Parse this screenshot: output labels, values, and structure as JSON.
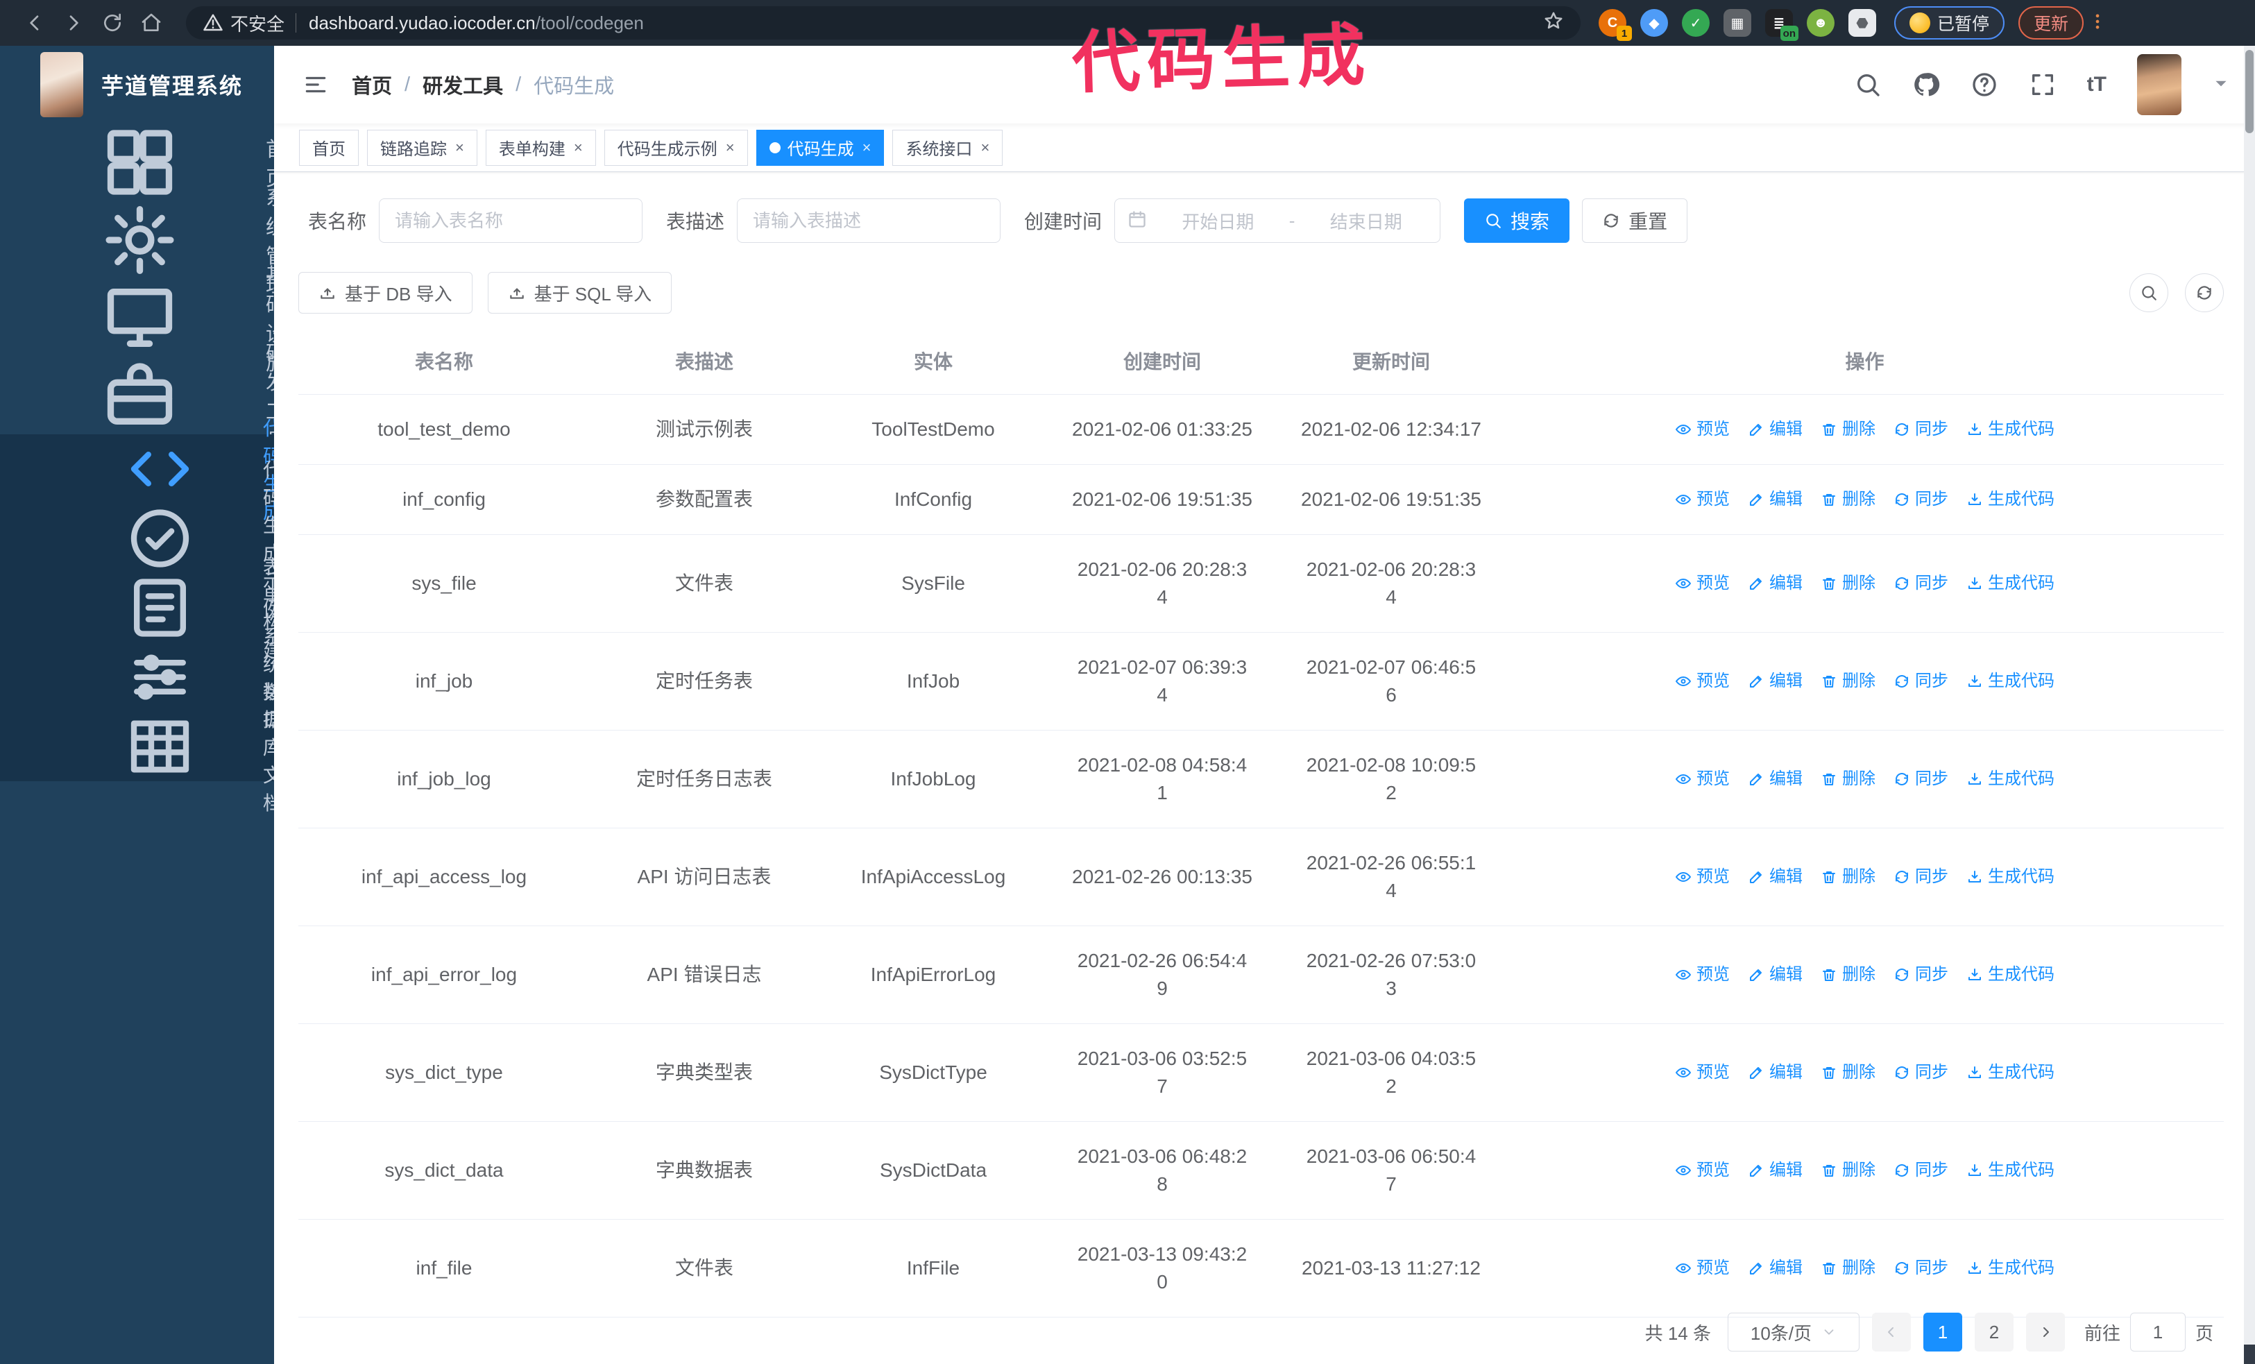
{
  "colors": {
    "primary": "#1890ff",
    "sidebar_bg": "#20415c",
    "submenu_bg": "#17334b",
    "annotation": "#f1315f",
    "active_menu": "#409eff"
  },
  "annotation": {
    "text": "代码生成"
  },
  "browser": {
    "security_label": "不安全",
    "url_host": "dashboard.yudao.iocoder.cn",
    "url_path": "/tool/codegen",
    "paused_badge": "已暂停",
    "update_button": "更新",
    "extensions": [
      {
        "name": "extension-refresh-icon",
        "shape": "round",
        "color": "#e8710a",
        "glyph": "C",
        "badge": "1",
        "badge_color": "#f9ab00"
      },
      {
        "name": "extension-gem-icon",
        "shape": "round",
        "color": "#4f9cf7",
        "glyph": "◆",
        "badge": "",
        "badge_color": ""
      },
      {
        "name": "extension-check-icon",
        "shape": "round",
        "color": "#34a853",
        "glyph": "✓",
        "badge": "",
        "badge_color": ""
      },
      {
        "name": "extension-grid-icon",
        "shape": "",
        "color": "#5f6368",
        "glyph": "▦",
        "badge": "",
        "badge_color": ""
      },
      {
        "name": "extension-clip-icon",
        "shape": "",
        "color": "#202124",
        "glyph": "≣",
        "badge": "on",
        "badge_color": "#34a853"
      },
      {
        "name": "extension-bot-icon",
        "shape": "round",
        "color": "#7cb342",
        "glyph": "☻",
        "badge": "",
        "badge_color": ""
      },
      {
        "name": "extension-puzzle-icon",
        "shape": "",
        "color": "#e8eaed",
        "glyph": "⬣",
        "badge": "",
        "badge_color": ""
      }
    ]
  },
  "app": {
    "title": "芋道管理系统"
  },
  "breadcrumb": {
    "items": [
      "首页",
      "研发工具",
      "代码生成"
    ],
    "separator": "/"
  },
  "sidebar": {
    "items": [
      {
        "label": "首页",
        "icon": "dashboard",
        "chevron": ""
      },
      {
        "label": "系统管理",
        "icon": "gear",
        "chevron": "down"
      },
      {
        "label": "基础设施",
        "icon": "monitor",
        "chevron": "down"
      },
      {
        "label": "研发工具",
        "icon": "toolbox",
        "chevron": "up"
      }
    ],
    "submenu": [
      {
        "label": "代码生成",
        "icon": "code",
        "active": true
      },
      {
        "label": "代码生成示例",
        "icon": "check-circle",
        "active": false
      },
      {
        "label": "表单构建",
        "icon": "form",
        "active": false
      },
      {
        "label": "系统接口",
        "icon": "api",
        "active": false
      },
      {
        "label": "数据库文档",
        "icon": "db-doc",
        "active": false
      }
    ]
  },
  "tabs": [
    {
      "label": "首页",
      "closable": false,
      "active": false
    },
    {
      "label": "链路追踪",
      "closable": true,
      "active": false
    },
    {
      "label": "表单构建",
      "closable": true,
      "active": false
    },
    {
      "label": "代码生成示例",
      "closable": true,
      "active": false
    },
    {
      "label": "代码生成",
      "closable": true,
      "active": true
    },
    {
      "label": "系统接口",
      "closable": true,
      "active": false
    }
  ],
  "filters": {
    "name_label": "表名称",
    "name_placeholder": "请输入表名称",
    "desc_label": "表描述",
    "desc_placeholder": "请输入表描述",
    "time_label": "创建时间",
    "start_placeholder": "开始日期",
    "end_placeholder": "结束日期",
    "range_separator": "-",
    "search_label": "搜索",
    "reset_label": "重置"
  },
  "toolbar": {
    "db_import_label": "基于 DB 导入",
    "sql_import_label": "基于 SQL 导入"
  },
  "table": {
    "columns": [
      "表名称",
      "表描述",
      "实体",
      "创建时间",
      "更新时间",
      "操作"
    ],
    "row_actions": [
      {
        "label": "预览",
        "icon": "eye",
        "name": "preview-link"
      },
      {
        "label": "编辑",
        "icon": "edit",
        "name": "edit-link"
      },
      {
        "label": "删除",
        "icon": "delete",
        "name": "delete-link"
      },
      {
        "label": "同步",
        "icon": "sync",
        "name": "sync-link"
      },
      {
        "label": "生成代码",
        "icon": "download",
        "name": "generate-code-link"
      }
    ],
    "rows": [
      {
        "name": "tool_test_demo",
        "desc": "测试示例表",
        "entity": "ToolTestDemo",
        "created": "2021-02-06 01:33:25",
        "updated": "2021-02-06 12:34:17"
      },
      {
        "name": "inf_config",
        "desc": "参数配置表",
        "entity": "InfConfig",
        "created": "2021-02-06 19:51:35",
        "updated": "2021-02-06 19:51:35"
      },
      {
        "name": "sys_file",
        "desc": "文件表",
        "entity": "SysFile",
        "created": "2021-02-06 20:28:3\n4",
        "updated": "2021-02-06 20:28:3\n4"
      },
      {
        "name": "inf_job",
        "desc": "定时任务表",
        "entity": "InfJob",
        "created": "2021-02-07 06:39:3\n4",
        "updated": "2021-02-07 06:46:5\n6"
      },
      {
        "name": "inf_job_log",
        "desc": "定时任务日志表",
        "entity": "InfJobLog",
        "created": "2021-02-08 04:58:4\n1",
        "updated": "2021-02-08 10:09:5\n2"
      },
      {
        "name": "inf_api_access_log",
        "desc": "API 访问日志表",
        "entity": "InfApiAccessLog",
        "created": "2021-02-26 00:13:35",
        "updated": "2021-02-26 06:55:1\n4"
      },
      {
        "name": "inf_api_error_log",
        "desc": "API 错误日志",
        "entity": "InfApiErrorLog",
        "created": "2021-02-26 06:54:4\n9",
        "updated": "2021-02-26 07:53:0\n3"
      },
      {
        "name": "sys_dict_type",
        "desc": "字典类型表",
        "entity": "SysDictType",
        "created": "2021-03-06 03:52:5\n7",
        "updated": "2021-03-06 04:03:5\n2"
      },
      {
        "name": "sys_dict_data",
        "desc": "字典数据表",
        "entity": "SysDictData",
        "created": "2021-03-06 06:48:2\n8",
        "updated": "2021-03-06 06:50:4\n7"
      },
      {
        "name": "inf_file",
        "desc": "文件表",
        "entity": "InfFile",
        "created": "2021-03-13 09:43:2\n0",
        "updated": "2021-03-13 11:27:12"
      }
    ]
  },
  "pagination": {
    "total": "共 14 条",
    "page_size": "10条/页",
    "pages": [
      {
        "label": "1",
        "active": true
      },
      {
        "label": "2",
        "active": false
      }
    ],
    "goto_label": "前往",
    "goto_value": "1",
    "page_suffix": "页"
  }
}
